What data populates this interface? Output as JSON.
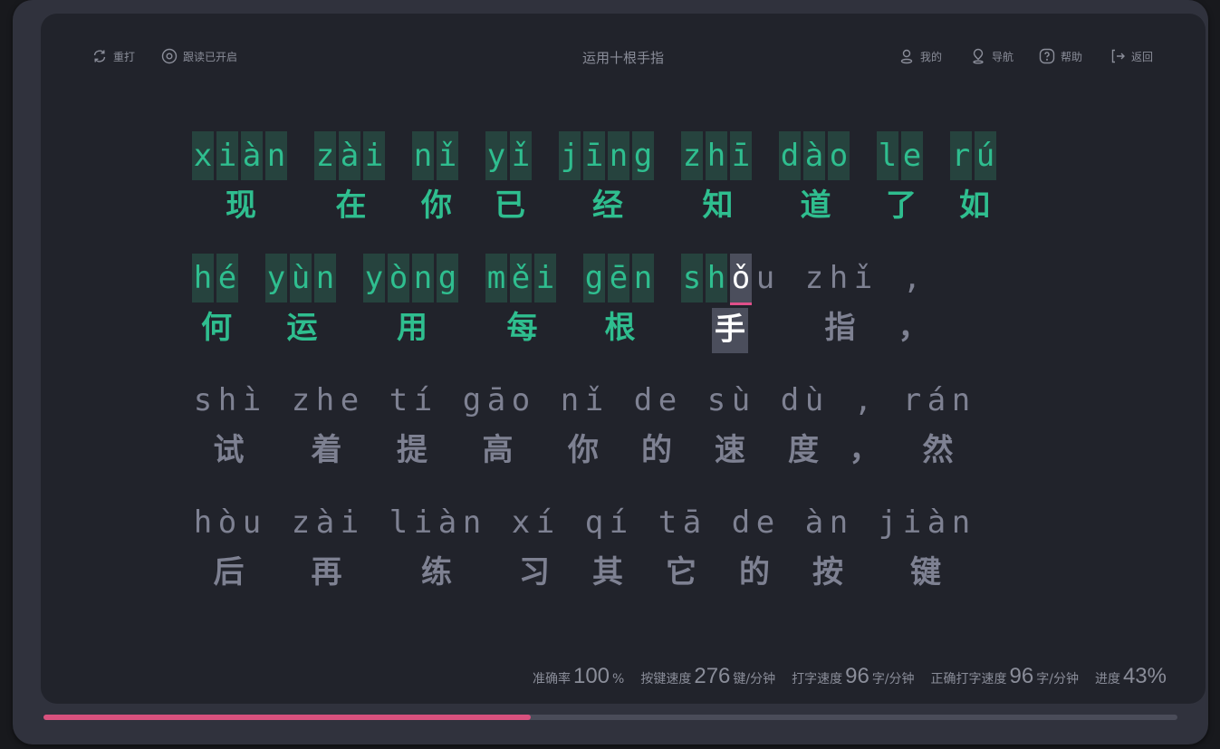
{
  "toolbar": {
    "left": [
      {
        "icon": "refresh-icon",
        "label": "重打"
      },
      {
        "icon": "target-icon",
        "label": "跟读已开启"
      }
    ],
    "title": "运用十根手指",
    "right": [
      {
        "icon": "user-icon",
        "label": "我的"
      },
      {
        "icon": "location-pin-icon",
        "label": "导航"
      },
      {
        "icon": "help-icon",
        "label": "帮助"
      },
      {
        "icon": "exit-icon",
        "label": "返回"
      }
    ]
  },
  "lines": [
    {
      "words": [
        {
          "py": "xiàn",
          "hz": "现",
          "state": "ok"
        },
        {
          "py": "zài",
          "hz": "在",
          "state": "ok"
        },
        {
          "py": "nǐ",
          "hz": "你",
          "state": "ok"
        },
        {
          "py": "yǐ",
          "hz": "已",
          "state": "ok"
        },
        {
          "py": "jīng",
          "hz": "经",
          "state": "ok"
        },
        {
          "py": "zhī",
          "hz": "知",
          "state": "ok"
        },
        {
          "py": "dào",
          "hz": "道",
          "state": "ok"
        },
        {
          "py": "le",
          "hz": "了",
          "state": "ok"
        },
        {
          "py": "rú",
          "hz": "如",
          "state": "ok"
        }
      ]
    },
    {
      "words": [
        {
          "py": "hé",
          "hz": "何",
          "state": "ok"
        },
        {
          "py": "yùn",
          "hz": "运",
          "state": "ok"
        },
        {
          "py": "yòng",
          "hz": "用",
          "state": "ok"
        },
        {
          "py": "měi",
          "hz": "每",
          "state": "ok"
        },
        {
          "py": "gēn",
          "hz": "根",
          "state": "ok"
        },
        {
          "py": "shǒu",
          "hz": "手",
          "state": "cur",
          "typed": 2
        },
        {
          "py": "zhǐ",
          "hz": "指",
          "state": "todo"
        },
        {
          "py": ",",
          "hz": "，",
          "state": "todo"
        }
      ]
    },
    {
      "words": [
        {
          "py": "shì",
          "hz": "试",
          "state": "todo"
        },
        {
          "py": "zhe",
          "hz": "着",
          "state": "todo"
        },
        {
          "py": "tí",
          "hz": "提",
          "state": "todo"
        },
        {
          "py": "gāo",
          "hz": "高",
          "state": "todo"
        },
        {
          "py": "nǐ",
          "hz": "你",
          "state": "todo"
        },
        {
          "py": "de",
          "hz": "的",
          "state": "todo"
        },
        {
          "py": "sù",
          "hz": "速",
          "state": "todo"
        },
        {
          "py": "dù",
          "hz": "度",
          "state": "todo"
        },
        {
          "py": ",",
          "hz": "，",
          "state": "todo"
        },
        {
          "py": "rán",
          "hz": "然",
          "state": "todo"
        }
      ]
    },
    {
      "words": [
        {
          "py": "hòu",
          "hz": "后",
          "state": "todo"
        },
        {
          "py": "zài",
          "hz": "再",
          "state": "todo"
        },
        {
          "py": "liàn",
          "hz": "练",
          "state": "todo"
        },
        {
          "py": "xí",
          "hz": "习",
          "state": "todo"
        },
        {
          "py": "qí",
          "hz": "其",
          "state": "todo"
        },
        {
          "py": "tā",
          "hz": "它",
          "state": "todo"
        },
        {
          "py": "de",
          "hz": "的",
          "state": "todo"
        },
        {
          "py": "àn",
          "hz": "按",
          "state": "todo"
        },
        {
          "py": "jiàn",
          "hz": "键",
          "state": "todo"
        }
      ]
    }
  ],
  "stats": {
    "accuracy_label": "准确率",
    "accuracy_value": "100",
    "accuracy_unit": "%",
    "key_speed_label": "按键速度",
    "key_speed_value": "276",
    "key_speed_unit": "键/分钟",
    "type_speed_label": "打字速度",
    "type_speed_value": "96",
    "type_speed_unit": "字/分钟",
    "correct_speed_label": "正确打字速度",
    "correct_speed_value": "96",
    "correct_speed_unit": "字/分钟",
    "progress_label": "进度",
    "progress_value": "43%"
  },
  "progress": {
    "fraction": 0.43
  },
  "colors": {
    "typed": "#2fbe8f",
    "typed_bg": "#26433e",
    "current_bg": "#4b4e5c",
    "cursor": "#e0508a",
    "pending": "#7e8192",
    "progress": "#d8517e"
  }
}
